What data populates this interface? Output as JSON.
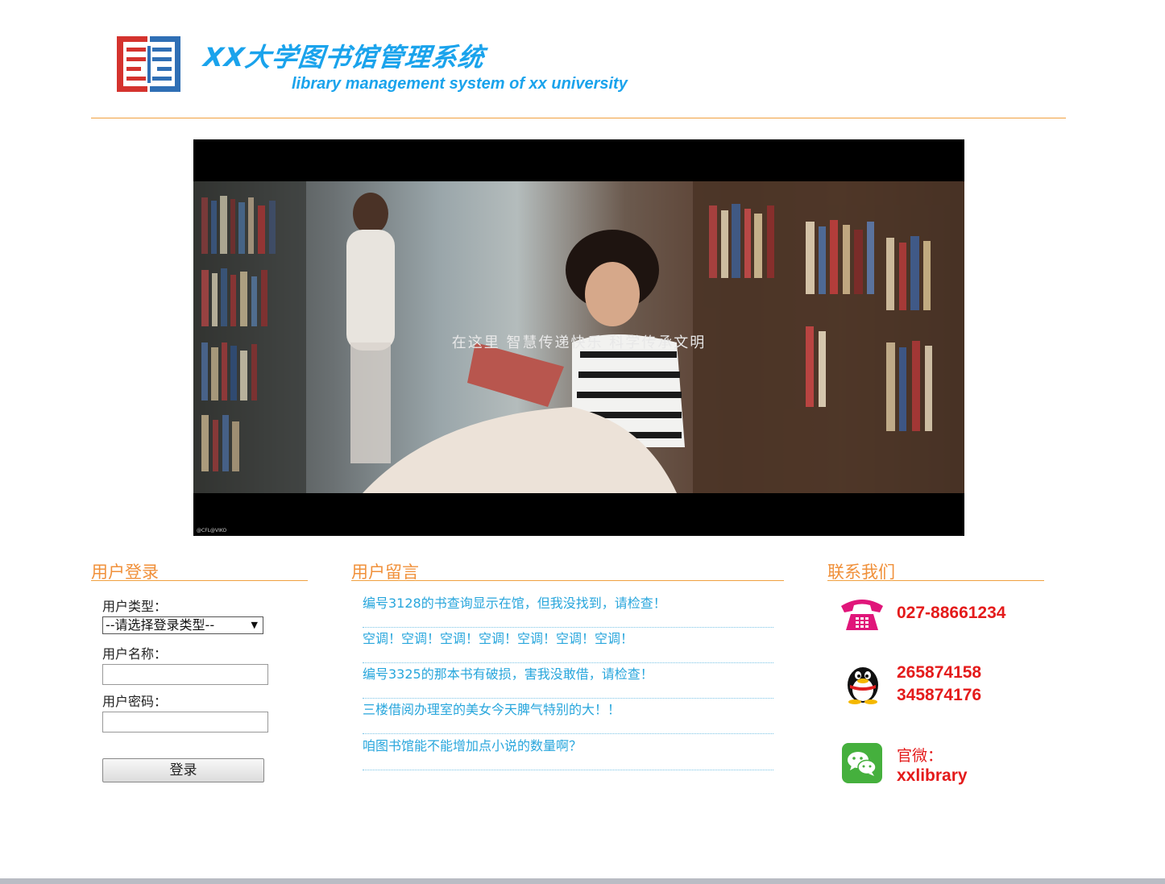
{
  "header": {
    "title_cn": "XX大学图书馆管理系统",
    "title_en": "library management system of xx university",
    "logo_icon": "library-logo-icon"
  },
  "banner": {
    "caption": "在这里  智慧传递快乐  科学传承文明",
    "watermark": "@CFL@VIKO"
  },
  "login": {
    "section_title": "用户登录",
    "type_label": "用户类型：",
    "type_selected": "--请选择登录类型--",
    "name_label": "用户名称：",
    "name_value": "",
    "password_label": "用户密码：",
    "password_value": "",
    "submit_label": "登录"
  },
  "messages": {
    "section_title": "用户留言",
    "items": [
      "编号3128的书查询显示在馆，但我没找到，请检查！",
      "空调！空调！空调！空调！空调！空调！空调！",
      "编号3325的那本书有破损，害我没敢借，请检查！",
      "三楼借阅办理室的美女今天脾气特别的大！！",
      "咱图书馆能不能增加点小说的数量啊？"
    ]
  },
  "contact": {
    "section_title": "联系我们",
    "phone": "027-88661234",
    "qq1": "265874158",
    "qq2": "345874176",
    "wechat_label": "官微：",
    "wechat_id": "xxlibrary",
    "icons": [
      "phone-icon",
      "qq-penguin-icon",
      "wechat-icon"
    ]
  },
  "colors": {
    "accent_orange": "#f0903a",
    "title_blue": "#1aa3ec",
    "link_blue": "#28a6dc",
    "contact_red": "#e41b1b"
  }
}
